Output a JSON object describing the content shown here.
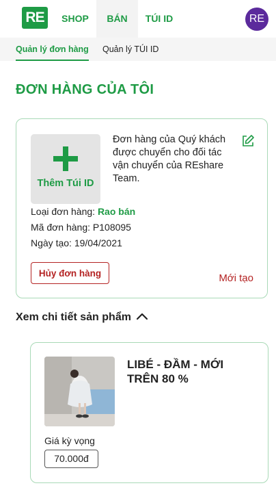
{
  "header": {
    "logo_text": "RE",
    "nav": [
      {
        "label": "SHOP"
      },
      {
        "label": "BÁN"
      },
      {
        "label": "TÚI ID"
      }
    ],
    "avatar_initials": "RE"
  },
  "subnav": {
    "tabs": [
      {
        "label": "Quản lý đơn hàng",
        "active": true
      },
      {
        "label": "Quản lý TÚI ID",
        "active": false
      }
    ]
  },
  "page": {
    "title": "ĐƠN HÀNG CỦA TÔI"
  },
  "order": {
    "add_tile_label": "Thêm Túi ID",
    "message": "Đơn hàng của Quý khách được chuyển cho đối tác vận chuyển của REshare Team.",
    "type_label": "Loại đơn hàng:",
    "type_value": "Rao bán",
    "code_label": "Mã đơn hàng:",
    "code_value": "P108095",
    "date_label": "Ngày tạo:",
    "date_value": "19/04/2021",
    "cancel_label": "Hủy đơn hàng",
    "status": "Mới tạo"
  },
  "details": {
    "toggle_label": "Xem chi tiết sản phẩm"
  },
  "product": {
    "name": "LIBÉ - ĐẦM - MỚI TRÊN 80 %",
    "price_label": "Giá kỳ vọng",
    "price_value": "70.000đ"
  },
  "colors": {
    "brand_green": "#1e9b45",
    "danger_red": "#b42323",
    "avatar_purple": "#5b2a9c"
  }
}
